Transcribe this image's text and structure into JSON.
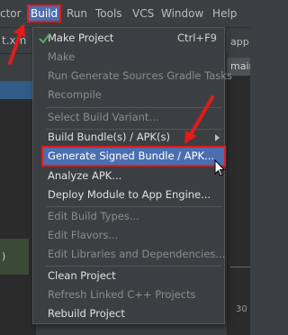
{
  "menubar": {
    "items": [
      {
        "label": "ctor"
      },
      {
        "label": "Build"
      },
      {
        "label": "Run"
      },
      {
        "label": "Tools"
      },
      {
        "label": "VCS"
      },
      {
        "label": "Window"
      },
      {
        "label": "Help"
      }
    ]
  },
  "background": {
    "editor_tab": "t.xm",
    "left_green_text": ")",
    "right_tab": "app",
    "right_main_tab": "main",
    "line_number": "30"
  },
  "build_menu": {
    "items": [
      {
        "label": "Make Project",
        "shortcut": "Ctrl+F9",
        "enabled": true
      },
      {
        "label": "Make",
        "enabled": false
      },
      {
        "label": "Run Generate Sources Gradle Tasks",
        "enabled": false
      },
      {
        "label": "Recompile",
        "enabled": false
      },
      {
        "label": "Select Build Variant...",
        "enabled": false
      },
      {
        "label": "Build Bundle(s) / APK(s)",
        "enabled": true,
        "submenu": true
      },
      {
        "label": "Generate Signed Bundle / APK...",
        "enabled": true,
        "highlighted": true
      },
      {
        "label": "Analyze APK...",
        "enabled": true
      },
      {
        "label": "Deploy Module to App Engine...",
        "enabled": true
      },
      {
        "label": "Edit Build Types...",
        "enabled": false
      },
      {
        "label": "Edit Flavors...",
        "enabled": false
      },
      {
        "label": "Edit Libraries and Dependencies...",
        "enabled": false
      },
      {
        "label": "Clean Project",
        "enabled": true
      },
      {
        "label": "Refresh Linked C++ Projects",
        "enabled": false
      },
      {
        "label": "Rebuild Project",
        "enabled": true
      }
    ]
  },
  "colors": {
    "menu_bg": "#3c3f41",
    "highlight": "#4b6eaf",
    "annotation_red": "#e21b1b",
    "disabled_text": "#8b8b8b"
  },
  "icons": {
    "make_project": "make-project-hammer-icon",
    "submenu": "chevron-right-icon",
    "cursor": "mouse-pointer-icon"
  }
}
